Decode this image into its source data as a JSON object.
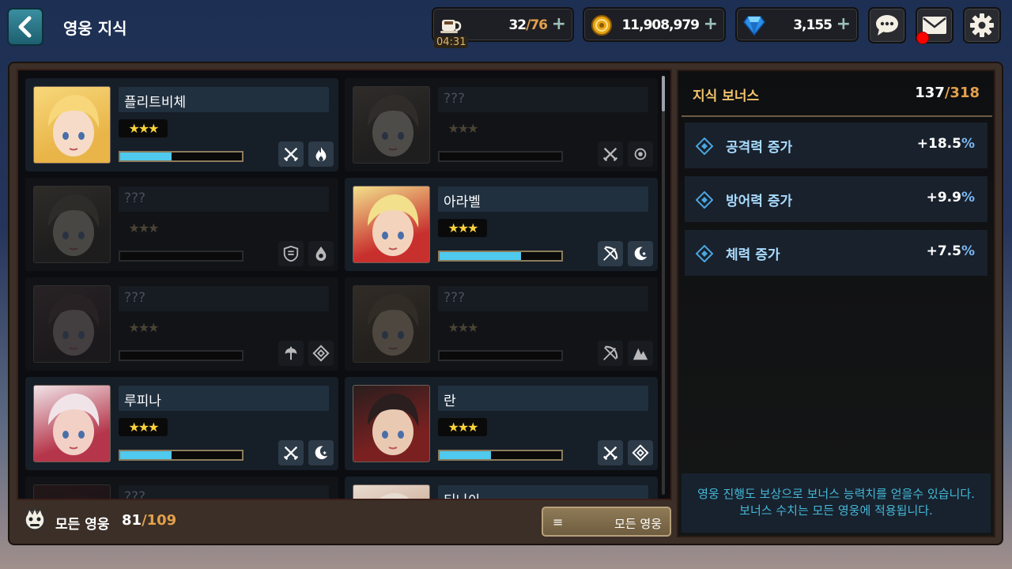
{
  "header": {
    "title": "영웅 지식"
  },
  "resources": {
    "stamina": {
      "current": "32",
      "max": "/76",
      "timer": "04:31",
      "plus": "+"
    },
    "gold": {
      "value": "11,908,979",
      "plus": "+"
    },
    "gems": {
      "value": "3,155",
      "plus": "+"
    }
  },
  "heroes": [
    {
      "name": "플리트비체",
      "stars": "★★★",
      "locked": false,
      "progress": 0.42,
      "classes": [
        "swords-icon",
        "fire-icon"
      ]
    },
    {
      "name": "???",
      "stars": "★★★",
      "locked": true,
      "progress": 0,
      "classes": [
        "swords-icon",
        "gear-icon"
      ]
    },
    {
      "name": "???",
      "stars": "★★★",
      "locked": true,
      "progress": 0,
      "classes": [
        "shield-icon",
        "water-drop-icon"
      ]
    },
    {
      "name": "아라벨",
      "stars": "★★★",
      "locked": false,
      "progress": 0.67,
      "classes": [
        "bow-icon",
        "moon-icon"
      ]
    },
    {
      "name": "???",
      "stars": "★★★",
      "locked": true,
      "progress": 0,
      "classes": [
        "axe-icon",
        "diamond-icon"
      ]
    },
    {
      "name": "???",
      "stars": "★★★",
      "locked": true,
      "progress": 0,
      "classes": [
        "bow-icon",
        "mountain-icon"
      ]
    },
    {
      "name": "루피나",
      "stars": "★★★",
      "locked": false,
      "progress": 0.42,
      "classes": [
        "swords-icon",
        "moon-icon"
      ]
    },
    {
      "name": "란",
      "stars": "★★★",
      "locked": false,
      "progress": 0.42,
      "classes": [
        "swords-icon",
        "diamond-icon"
      ]
    },
    {
      "name": "???",
      "stars": "",
      "locked": true,
      "progress": 0,
      "classes": []
    },
    {
      "name": "티나아",
      "stars": "",
      "locked": false,
      "progress": 0,
      "classes": []
    }
  ],
  "footer": {
    "label": "모든 영웅",
    "current": "81",
    "max": "/109",
    "filter_label": "모든 영웅",
    "menu_icon": "≡"
  },
  "bonus": {
    "title": "지식 보너스",
    "current": "137",
    "max": "/318",
    "stats": [
      {
        "label": "공격력 증가",
        "value": "+18.5",
        "unit": "%"
      },
      {
        "label": "방어력 증가",
        "value": "+9.9",
        "unit": "%"
      },
      {
        "label": "체력 증가",
        "value": "+7.5",
        "unit": "%"
      }
    ],
    "info_line1": "영웅 진행도 보상으로 보너스 능력치를 얻을수 있습니다.",
    "info_line2": "보너스 수치는 모든 영웅에 적용됩니다."
  }
}
